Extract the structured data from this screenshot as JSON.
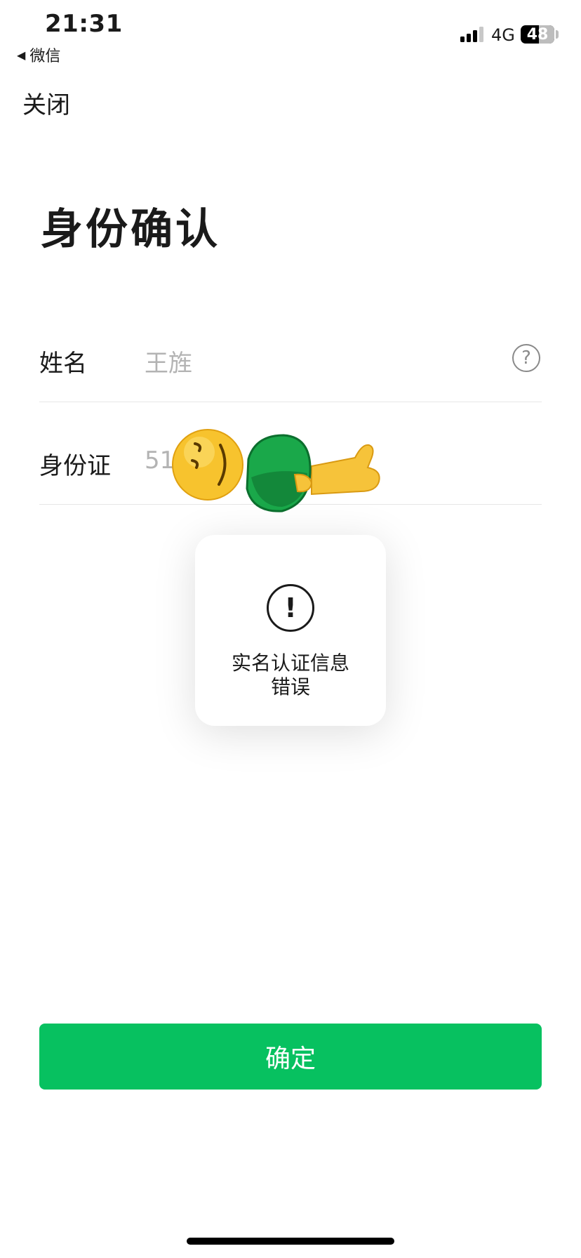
{
  "status_bar": {
    "time": "21:31",
    "back_app": "微信",
    "network": "4G",
    "battery": "48"
  },
  "nav": {
    "close": "关闭"
  },
  "page": {
    "title": "身份确认"
  },
  "form": {
    "name_label": "姓名",
    "name_value": "王旌",
    "id_label": "身份证",
    "id_value": "511"
  },
  "toast": {
    "line1": "实名认证信息",
    "line2": "错误"
  },
  "actions": {
    "confirm": "确定"
  },
  "icons": [
    "signal-icon",
    "back-arrow-icon",
    "help-icon",
    "alert-icon",
    "sleeping-face-sticker",
    "lying-person-sticker"
  ],
  "colors": {
    "accent": "#07c160",
    "placeholder": "#b3b3b3"
  }
}
